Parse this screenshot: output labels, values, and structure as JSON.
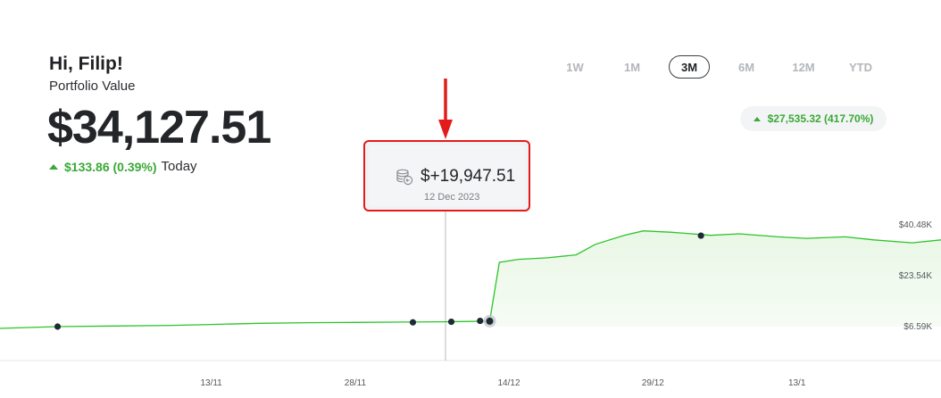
{
  "header": {
    "greeting": "Hi, Filip!",
    "subtitle": "Portfolio Value",
    "portfolio_value": "$34,127.51",
    "today_change": "$133.86 (0.39%)",
    "today_label": "Today"
  },
  "ranges": {
    "items": [
      "1W",
      "1M",
      "3M",
      "6M",
      "12M",
      "YTD"
    ],
    "active": "3M"
  },
  "period_change": "$27,535.32 (417.70%)",
  "tooltip": {
    "value": "$+19,947.51",
    "date": "12 Dec 2023",
    "icon": "coins-icon"
  },
  "colors": {
    "positive": "#3aa935",
    "line": "#2ec42a",
    "highlight_border": "#e41b1b",
    "arrow": "#e41b1b",
    "marker": "#1f2a38"
  },
  "chart_data": {
    "type": "area",
    "x_ticks": [
      "13/11",
      "28/11",
      "14/12",
      "29/12",
      "13/1"
    ],
    "y_ticks": [
      "$40.48K",
      "$23.54K",
      "$6.59K"
    ],
    "ylim": [
      6590,
      40480
    ],
    "x_range": [
      "2023-10-22",
      "2024-01-28"
    ],
    "grid": false,
    "series": [
      {
        "points": [
          [
            "2023-10-22",
            6000
          ],
          [
            "2023-10-28",
            6590
          ],
          [
            "2023-11-03",
            6800
          ],
          [
            "2023-11-09",
            7000
          ],
          [
            "2023-11-13",
            7300
          ],
          [
            "2023-11-18",
            7700
          ],
          [
            "2023-11-23",
            7900
          ],
          [
            "2023-11-28",
            8000
          ],
          [
            "2023-12-03",
            8100
          ],
          [
            "2023-12-07",
            8200
          ],
          [
            "2023-12-10",
            8300
          ],
          [
            "2023-12-12",
            8400
          ],
          [
            "2023-12-13",
            28000
          ],
          [
            "2023-12-15",
            29000
          ],
          [
            "2023-12-18",
            29500
          ],
          [
            "2023-12-21",
            30500
          ],
          [
            "2023-12-23",
            34000
          ],
          [
            "2023-12-26",
            37000
          ],
          [
            "2023-12-28",
            38500
          ],
          [
            "2023-12-31",
            38000
          ],
          [
            "2024-01-04",
            37000
          ],
          [
            "2024-01-07",
            37500
          ],
          [
            "2024-01-11",
            36500
          ],
          [
            "2024-01-14",
            36000
          ],
          [
            "2024-01-18",
            36500
          ],
          [
            "2024-01-21",
            35500
          ],
          [
            "2024-01-25",
            34500
          ],
          [
            "2024-01-28",
            35500
          ]
        ]
      }
    ],
    "markers": [
      [
        "2023-10-28",
        6590
      ],
      [
        "2023-12-04",
        8000
      ],
      [
        "2023-12-08",
        8200
      ],
      [
        "2023-12-11",
        8500
      ],
      [
        "2024-01-03",
        36900
      ]
    ],
    "selected_point": [
      "2023-12-12",
      8400
    ]
  }
}
